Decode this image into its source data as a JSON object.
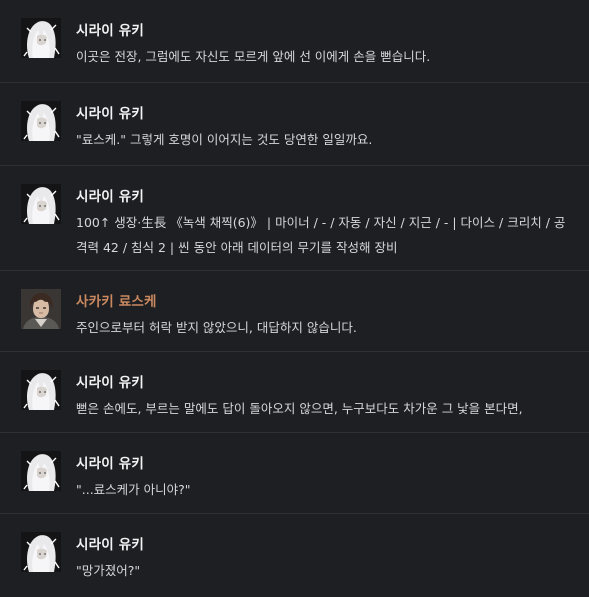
{
  "colors": {
    "background": "#1e1f22",
    "divider": "#2e3035",
    "name_default": "#f2f3f5",
    "name_ryosuke": "#c9885f",
    "message_text": "#d5d7da"
  },
  "messages": [
    {
      "author": "시라이 유키",
      "avatar_icon": "white-haired-character-avatar",
      "lines": [
        "이곳은 전장, 그럼에도 자신도 모르게 앞에 선 이에게 손을 뻗습니다."
      ]
    },
    {
      "author": "시라이 유키",
      "avatar_icon": "white-haired-character-avatar",
      "lines": [
        "\"료스케.\" 그렇게 호명이 이어지는 것도 당연한 일일까요."
      ]
    },
    {
      "author": "시라이 유키",
      "avatar_icon": "white-haired-character-avatar",
      "lines": [
        "100↑ 생장·生長 《녹색 채찍(6)》 | 마이너 / - / 자동 / 자신 / 지근 / - | 다이스  / 크리치  / 공",
        "격력 42 / 침식 2 | 씬 동안 아래 데이터의 무기를 작성해 장비"
      ]
    },
    {
      "author": "사카키 료스케",
      "avatar_icon": "dark-haired-character-avatar",
      "lines": [
        "주인으로부터 허락 받지 않았으니, 대답하지 않습니다."
      ]
    },
    {
      "author": "시라이 유키",
      "avatar_icon": "white-haired-character-avatar",
      "lines": [
        "뻗은 손에도, 부르는 말에도 답이 돌아오지 않으면, 누구보다도 차가운 그 낯을 본다면,"
      ]
    },
    {
      "author": "시라이 유키",
      "avatar_icon": "white-haired-character-avatar",
      "lines": [
        "\"...료스케가 아니야?\""
      ]
    },
    {
      "author": "시라이 유키",
      "avatar_icon": "white-haired-character-avatar",
      "lines": [
        "\"망가졌어?\""
      ]
    }
  ]
}
